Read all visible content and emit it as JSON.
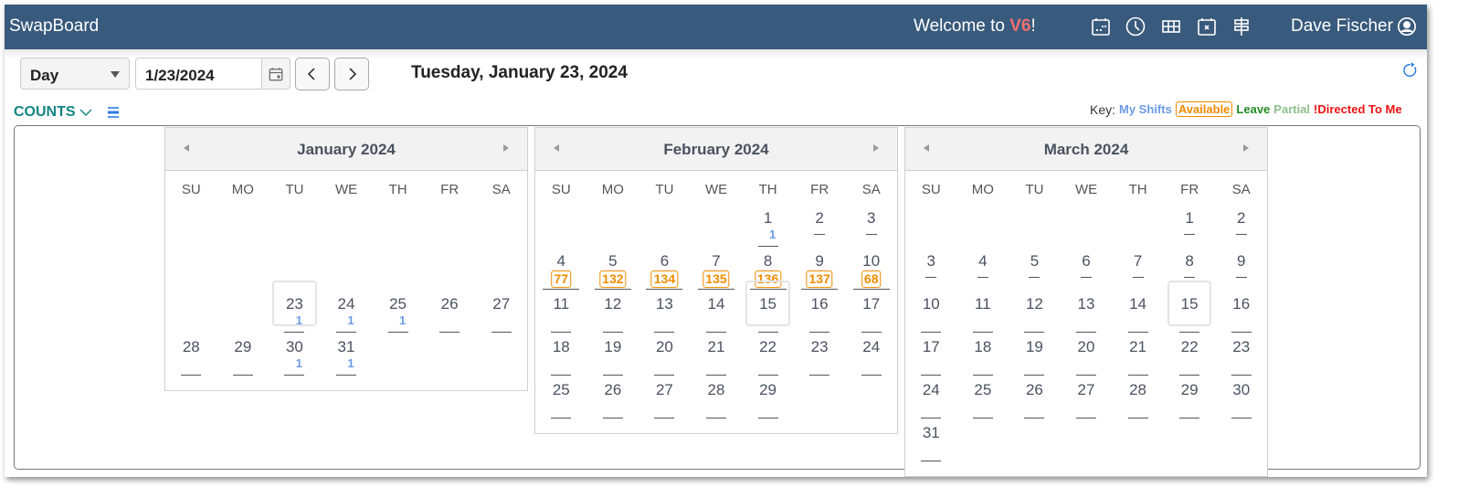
{
  "header": {
    "brand": "SwapBoard",
    "welcome_prefix": "Welcome to ",
    "welcome_version": "V6",
    "welcome_suffix": "!",
    "icons": [
      "calendar-dots-icon",
      "clock-icon",
      "grid-icon",
      "calendar-x-icon",
      "signpost-icon"
    ],
    "user_name": "Dave Fischer",
    "colors": {
      "bar": "#385a7c",
      "version": "#f07070"
    }
  },
  "toolbar": {
    "view_select": "Day",
    "date_value": "1/23/2024",
    "prev_label": "<",
    "next_label": ">",
    "page_title": "Tuesday, January 23, 2024"
  },
  "counts": {
    "label": "COUNTS"
  },
  "key": {
    "label": "Key:",
    "my_shifts": "My Shifts",
    "available": "Available",
    "leave": "Leave",
    "partial": "Partial",
    "directed": "!Directed To Me",
    "colors": {
      "my_shifts": "#6b9be8",
      "available": "#f08c00",
      "leave": "#228b22",
      "partial": "#8dbf8d",
      "directed": "#ee1111"
    }
  },
  "weekdays": [
    "SU",
    "MO",
    "TU",
    "WE",
    "TH",
    "FR",
    "SA"
  ],
  "calendars": [
    {
      "title": "January 2024",
      "rows": [
        [
          null,
          null,
          {
            "d": "23",
            "cnt": "1",
            "sel": true
          },
          {
            "d": "24",
            "cnt": "1"
          },
          {
            "d": "25",
            "cnt": "1"
          },
          {
            "d": "26"
          },
          {
            "d": "27"
          }
        ],
        [
          {
            "d": "28"
          },
          {
            "d": "29"
          },
          {
            "d": "30",
            "cnt": "1"
          },
          {
            "d": "31",
            "cnt": "1"
          },
          null,
          null,
          null
        ]
      ],
      "leading_blank_rows": 2
    },
    {
      "title": "February 2024",
      "rows": [
        [
          null,
          null,
          null,
          null,
          {
            "d": "1",
            "cnt": "1"
          },
          {
            "d": "2",
            "short": true
          },
          {
            "d": "3",
            "short": true
          }
        ],
        [
          {
            "d": "4",
            "avail": "77"
          },
          {
            "d": "5",
            "avail": "132"
          },
          {
            "d": "6",
            "avail": "134"
          },
          {
            "d": "7",
            "avail": "135"
          },
          {
            "d": "8",
            "avail": "136"
          },
          {
            "d": "9",
            "avail": "137"
          },
          {
            "d": "10",
            "avail": "68"
          }
        ],
        [
          {
            "d": "11"
          },
          {
            "d": "12"
          },
          {
            "d": "13"
          },
          {
            "d": "14"
          },
          {
            "d": "15",
            "sel": true
          },
          {
            "d": "16"
          },
          {
            "d": "17"
          }
        ],
        [
          {
            "d": "18"
          },
          {
            "d": "19"
          },
          {
            "d": "20"
          },
          {
            "d": "21"
          },
          {
            "d": "22"
          },
          {
            "d": "23"
          },
          {
            "d": "24"
          }
        ],
        [
          {
            "d": "25"
          },
          {
            "d": "26"
          },
          {
            "d": "27"
          },
          {
            "d": "28"
          },
          {
            "d": "29"
          },
          null,
          null
        ]
      ],
      "leading_blank_rows": 0
    },
    {
      "title": "March 2024",
      "rows": [
        [
          null,
          null,
          null,
          null,
          null,
          {
            "d": "1",
            "short": true
          },
          {
            "d": "2",
            "short": true
          }
        ],
        [
          {
            "d": "3",
            "short": true
          },
          {
            "d": "4",
            "short": true
          },
          {
            "d": "5",
            "short": true
          },
          {
            "d": "6",
            "short": true
          },
          {
            "d": "7",
            "short": true
          },
          {
            "d": "8",
            "short": true
          },
          {
            "d": "9",
            "short": true
          }
        ],
        [
          {
            "d": "10"
          },
          {
            "d": "11"
          },
          {
            "d": "12"
          },
          {
            "d": "13"
          },
          {
            "d": "14"
          },
          {
            "d": "15",
            "sel": true
          },
          {
            "d": "16"
          }
        ],
        [
          {
            "d": "17"
          },
          {
            "d": "18"
          },
          {
            "d": "19"
          },
          {
            "d": "20"
          },
          {
            "d": "21"
          },
          {
            "d": "22"
          },
          {
            "d": "23"
          }
        ],
        [
          {
            "d": "24"
          },
          {
            "d": "25"
          },
          {
            "d": "26"
          },
          {
            "d": "27"
          },
          {
            "d": "28"
          },
          {
            "d": "29"
          },
          {
            "d": "30"
          }
        ],
        [
          {
            "d": "31"
          },
          null,
          null,
          null,
          null,
          null,
          null
        ]
      ],
      "leading_blank_rows": 0
    }
  ]
}
